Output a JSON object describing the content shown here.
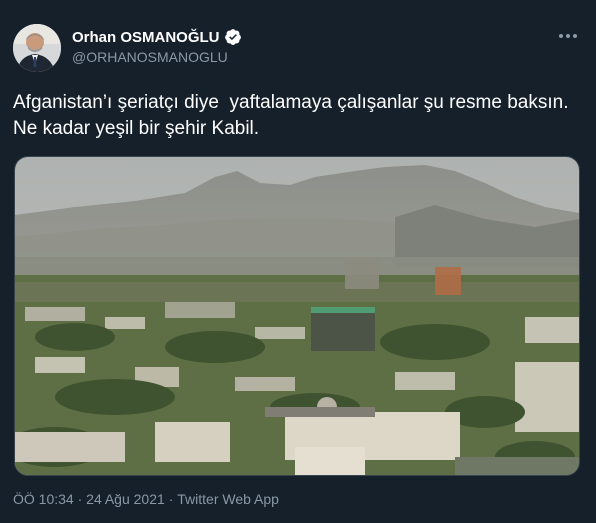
{
  "author": {
    "display_name": "Orhan OSMANOĞLU",
    "handle": "@ORHANOSMANOGLU",
    "verified": true
  },
  "tweet": {
    "text": "Afganistan’ı şeriatçı diye  yaftalamaya çalışanlar şu resme baksın. Ne kadar yeşil bir şehir Kabil."
  },
  "meta": {
    "time": "ÖÖ 10:34",
    "separator1": "·",
    "date": "24 Ağu 2021",
    "separator2": "·",
    "source": "Twitter Web App"
  },
  "icons": {
    "verified": "verified-badge-icon",
    "more": "more-options-icon"
  },
  "colors": {
    "background": "#15202b",
    "secondary_text": "#8b98a5",
    "verified": "#ffffff"
  }
}
